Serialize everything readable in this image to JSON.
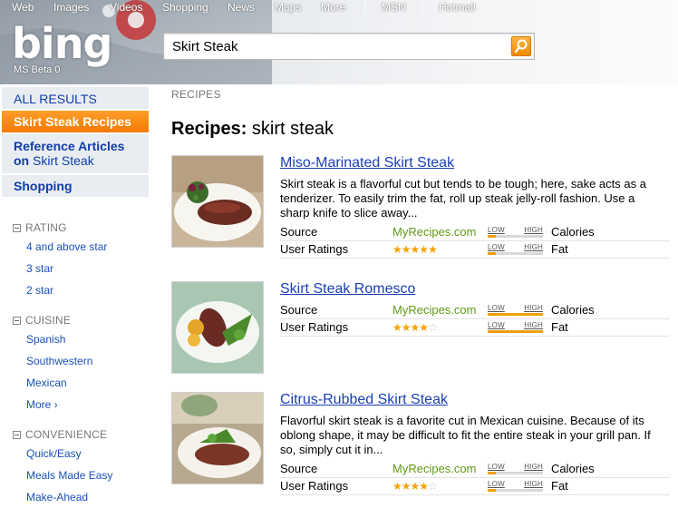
{
  "topnav": {
    "items": [
      "Web",
      "Images",
      "Videos",
      "Shopping",
      "News",
      "Maps",
      "More"
    ],
    "right": [
      "MSN",
      "Hotmail"
    ]
  },
  "header": {
    "logo": "bing",
    "beta_label": "MS Beta 0"
  },
  "search": {
    "query": "Skirt Steak",
    "icon": "search-icon"
  },
  "sidebar": {
    "all_results": "ALL RESULTS",
    "active": "Skirt Steak Recipes",
    "reference_line1": "Reference Articles",
    "reference_on": "on",
    "reference_topic": "Skirt Steak",
    "shopping": "Shopping",
    "facets": [
      {
        "heading": "RATING",
        "items": [
          "4 and above star",
          "3 star",
          "2 star"
        ]
      },
      {
        "heading": "CUISINE",
        "items": [
          "Spanish",
          "Southwestern",
          "Mexican",
          "More ›"
        ]
      },
      {
        "heading": "CONVENIENCE",
        "items": [
          "Quick/Easy",
          "Meals Made Easy",
          "Make-Ahead"
        ]
      }
    ]
  },
  "main": {
    "section_label": "RECIPES",
    "title_bold": "Recipes:",
    "title_rest": " skirt steak",
    "labels": {
      "source": "Source",
      "ratings": "User Ratings",
      "low": "LOW",
      "high": "HIGH",
      "calories": "Calories",
      "fat": "Fat"
    },
    "results": [
      {
        "title": "Miso-Marinated Skirt Steak",
        "description": "Skirt steak is a flavorful cut but tends to be tough; here, sake acts as a tenderizer. To easily trim the fat, roll up steak jelly-roll fashion. Use a sharp knife to slice away...",
        "source": "MyRecipes.com",
        "rating": 5,
        "calories_level": 0.15,
        "fat_level": 0.15
      },
      {
        "title": "Skirt Steak Romesco",
        "description": "",
        "source": "MyRecipes.com",
        "rating": 4,
        "calories_level": 1.0,
        "fat_level": 1.0
      },
      {
        "title": "Citrus-Rubbed Skirt Steak",
        "description": "Flavorful skirt steak is a favorite cut in Mexican cuisine. Because of its oblong shape, it may be difficult to fit the entire steak in your grill pan. If so, simply cut it in...",
        "source": "MyRecipes.com",
        "rating": 4,
        "calories_level": 0.15,
        "fat_level": 0.15
      }
    ]
  },
  "colors": {
    "accent": "#f47a00",
    "link": "#1a3fb6",
    "source_green": "#5f9a14",
    "star": "#f5a200"
  }
}
